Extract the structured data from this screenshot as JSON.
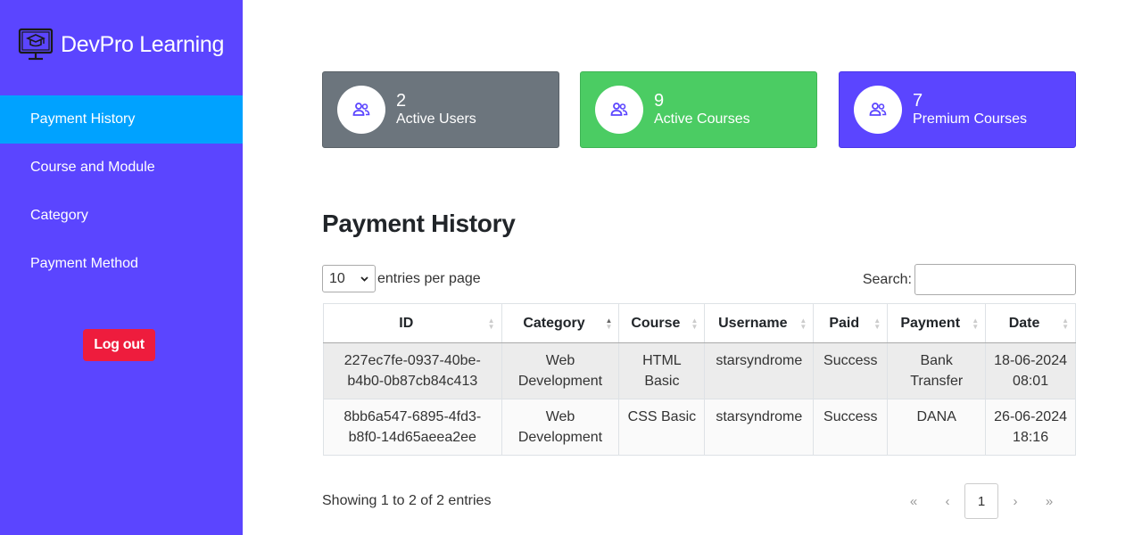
{
  "app": {
    "brand": "DevPro Learning"
  },
  "sidebar": {
    "items": [
      {
        "label": "Payment History",
        "active": true
      },
      {
        "label": "Course and Module"
      },
      {
        "label": "Category"
      },
      {
        "label": "Payment Method"
      }
    ],
    "logout_label": "Log out"
  },
  "stats": [
    {
      "value": "2",
      "label": "Active Users",
      "color": "#6c757d"
    },
    {
      "value": "9",
      "label": "Active Courses",
      "color": "#4bcc63"
    },
    {
      "value": "7",
      "label": "Premium Courses",
      "color": "#5b45ff"
    }
  ],
  "page": {
    "title": "Payment History"
  },
  "table_controls": {
    "entries_value": "10",
    "entries_suffix": "entries per page",
    "search_label": "Search:",
    "search_value": ""
  },
  "table": {
    "columns": [
      "ID",
      "Category",
      "Course",
      "Username",
      "Paid",
      "Payment",
      "Date"
    ],
    "rows": [
      {
        "id": "227ec7fe-0937-40be-b4b0-0b87cb84c413",
        "category": "Web Development",
        "course": "HTML Basic",
        "username": "starsyndrome",
        "paid": "Success",
        "payment": "Bank Transfer",
        "date": "18-06-2024 08:01"
      },
      {
        "id": "8bb6a547-6895-4fd3-b8f0-14d65aeea2ee",
        "category": "Web Development",
        "course": "CSS Basic",
        "username": "starsyndrome",
        "paid": "Success",
        "payment": "DANA",
        "date": "26-06-2024 18:16"
      }
    ]
  },
  "footer": {
    "info": "Showing 1 to 2 of 2 entries",
    "pagination": {
      "first": "«",
      "prev": "‹",
      "current": "1",
      "next": "›",
      "last": "»"
    }
  },
  "colors": {
    "sidebar": "#5b45ff",
    "active_nav": "#00a2ff",
    "logout": "#ee1c3d",
    "stat_icon": "#5b45ff"
  }
}
